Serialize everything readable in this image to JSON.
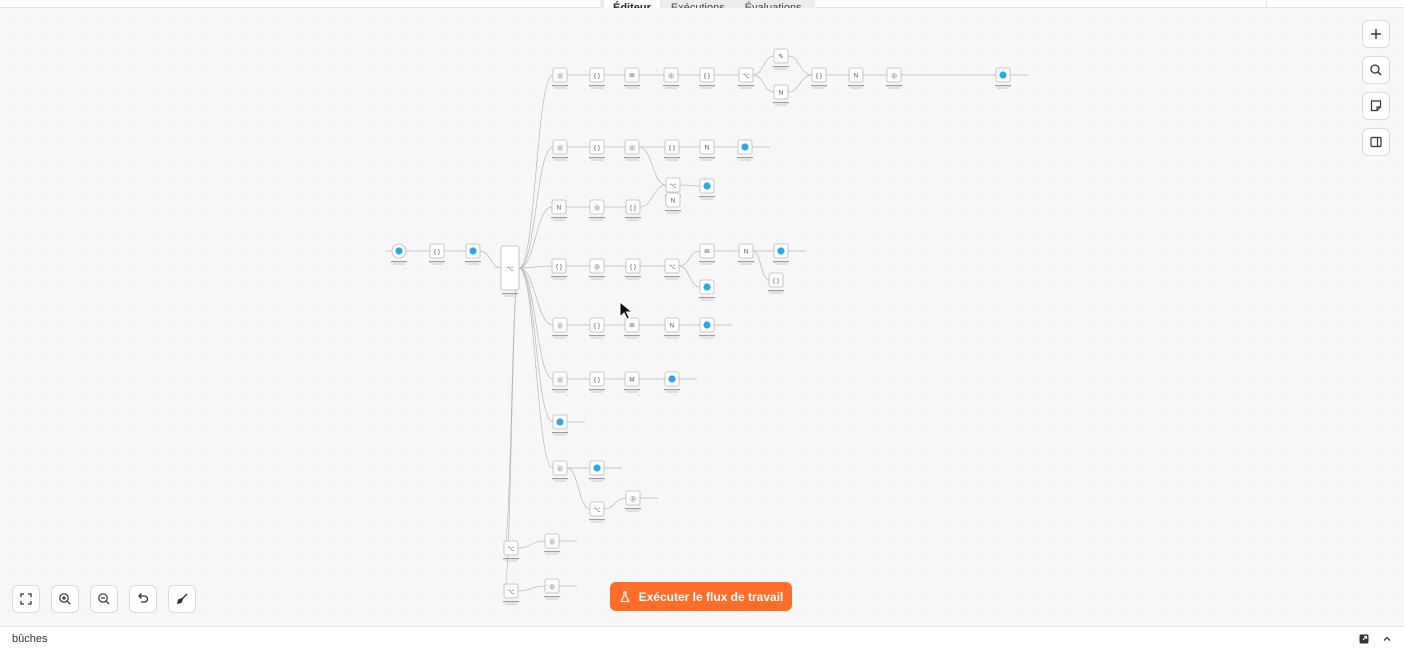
{
  "tabs": [
    {
      "label": "Éditeur",
      "active": true
    },
    {
      "label": "Exécutions",
      "active": false
    },
    {
      "label": "Évaluations",
      "active": false
    }
  ],
  "toolbar": {
    "zoom_to_fit_icon": "fit-view-icon",
    "zoom_in_icon": "zoom-in-icon",
    "zoom_out_icon": "zoom-out-icon",
    "undo_icon": "undo-icon",
    "tidy_icon": "broom-icon"
  },
  "right_toolbar": [
    "plus-icon",
    "search-icon",
    "sticky-note-icon",
    "panel-icon"
  ],
  "run_button": {
    "label": "Exécuter le flux de travail",
    "icon": "flask-icon",
    "color": "#ff6d2a"
  },
  "status_bar": {
    "logs_label": "bûches"
  },
  "colors": {
    "accent": "#ff6d2a",
    "telegram": "#29a9eb"
  }
}
